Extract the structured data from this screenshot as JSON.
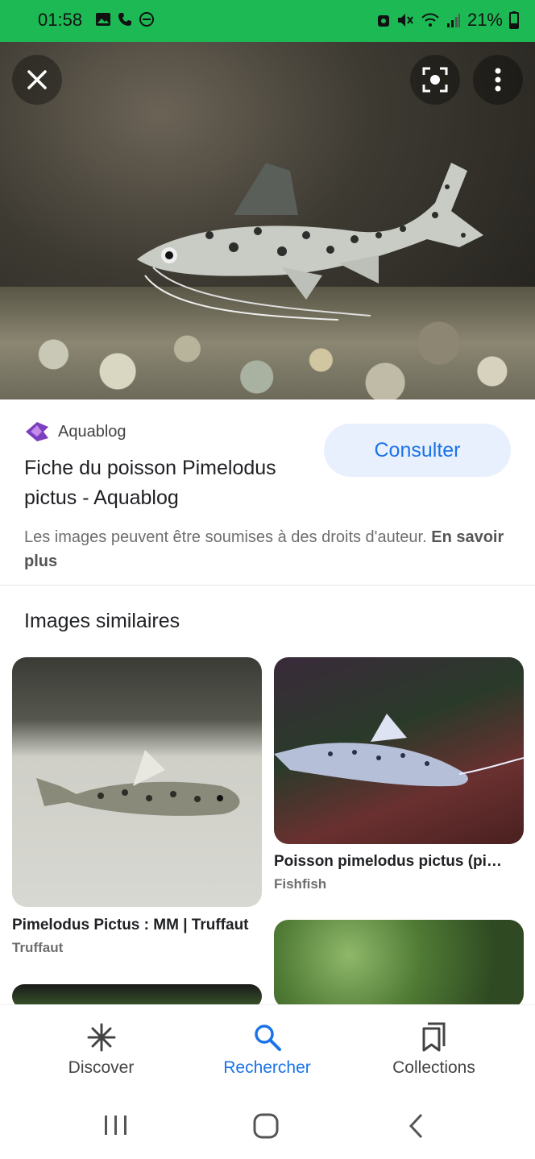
{
  "status_bar": {
    "time": "01:58",
    "battery": "21%"
  },
  "result": {
    "source_name": "Aquablog",
    "title": "Fiche du poisson Pimelodus pictus - Aquablog",
    "consult_label": "Consulter",
    "rights_text": "Les images peuvent être soumises à des droits d'auteur.",
    "rights_link": "En savoir plus"
  },
  "similar": {
    "section_title": "Images similaires",
    "items": [
      {
        "title": "Pimelodus Pictus : MM | Truffaut",
        "source": "Truffaut"
      },
      {
        "title": "Poisson pimelodus pictus (pictus)",
        "source": "Fishfish"
      }
    ]
  },
  "nav": {
    "items": [
      {
        "label": "Discover",
        "icon": "asterisk-icon"
      },
      {
        "label": "Rechercher",
        "icon": "search-icon"
      },
      {
        "label": "Collections",
        "icon": "collections-icon"
      }
    ],
    "active": "Rechercher",
    "active_color": "#1a73e8"
  }
}
